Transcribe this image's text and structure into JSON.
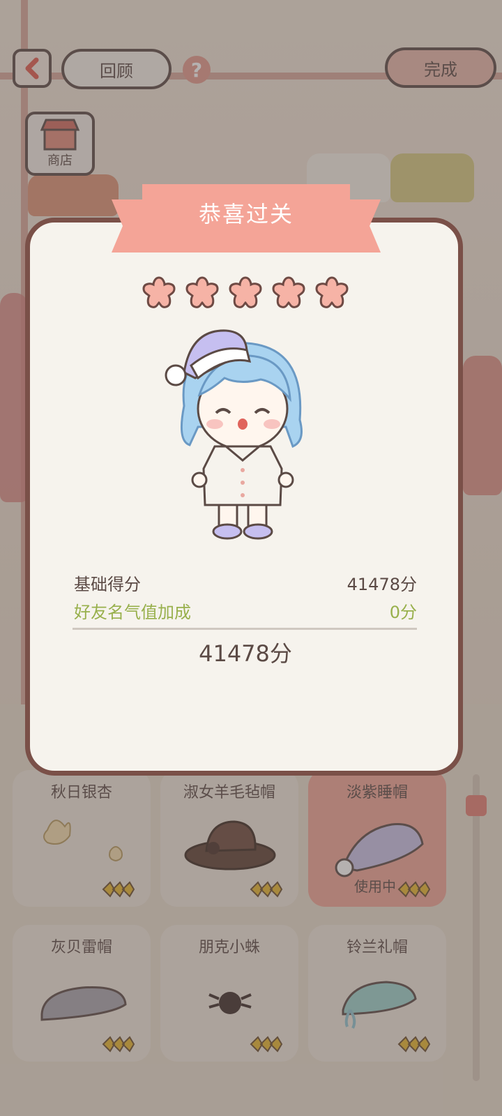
{
  "header": {
    "back_icon": "chevron-left-icon",
    "review_label": "回顾",
    "help_label": "?",
    "done_label": "完成",
    "shop_label": "商店"
  },
  "dialog": {
    "title": "恭喜过关",
    "stars_earned": 5,
    "stars_total": 5,
    "base_score_label": "基础得分",
    "base_score_value": "41478分",
    "bonus_label": "好友名气值加成",
    "bonus_value": "0分",
    "total_value": "41478分"
  },
  "items": [
    {
      "name": "秋日银杏",
      "icon": "ginkgo-leaf-icon",
      "in_use": false
    },
    {
      "name": "淑女羊毛毡帽",
      "icon": "brown-hat-icon",
      "in_use": false
    },
    {
      "name": "淡紫睡帽",
      "icon": "purple-nightcap-icon",
      "in_use": true,
      "status": "使用中"
    },
    {
      "name": "灰贝雷帽",
      "icon": "gray-beret-icon",
      "in_use": false
    },
    {
      "name": "朋克小蛛",
      "icon": "spider-icon",
      "in_use": false
    },
    {
      "name": "铃兰礼帽",
      "icon": "teal-hat-icon",
      "in_use": false
    }
  ],
  "colors": {
    "accent": "#f4a497",
    "border": "#7a5048",
    "text": "#5b4a45",
    "bonus_text": "#98b04c",
    "star": "#f6b3a6"
  }
}
